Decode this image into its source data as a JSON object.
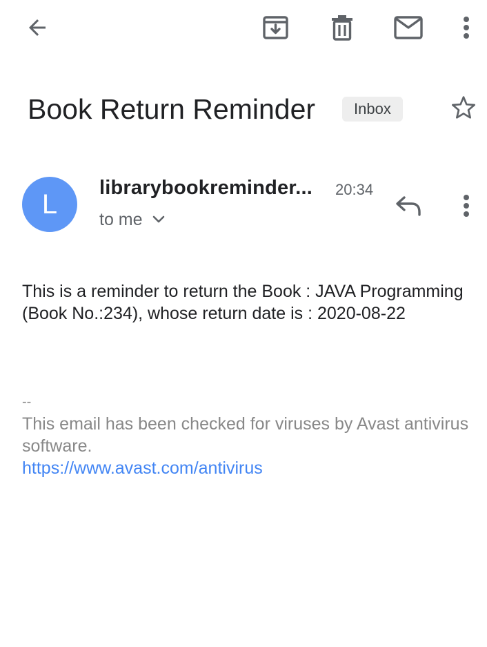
{
  "toolbar": {
    "back_icon": "arrow-back-icon",
    "archive_icon": "archive-icon",
    "delete_icon": "trash-icon",
    "mark_unread_icon": "mail-icon",
    "more_icon": "more-vert-icon"
  },
  "subject": {
    "title": "Book Return Reminder",
    "label": "Inbox",
    "star_icon": "star-outline-icon"
  },
  "sender": {
    "avatar_letter": "L",
    "avatar_color": "#5e97f6",
    "name": "librarybookreminder...",
    "time": "20:34",
    "recipient": "to me",
    "expand_icon": "chevron-down-icon",
    "reply_icon": "reply-icon",
    "more_icon": "more-vert-icon"
  },
  "body": {
    "text": "This is a reminder to return the Book : JAVA Programming (Book No.:234), whose return date is : 2020-08-22"
  },
  "signature": {
    "separator": "--",
    "text": "This email has been checked for viruses by Avast antivirus software.",
    "link": "https://www.avast.com/antivirus",
    "link_color": "#4285f4"
  }
}
